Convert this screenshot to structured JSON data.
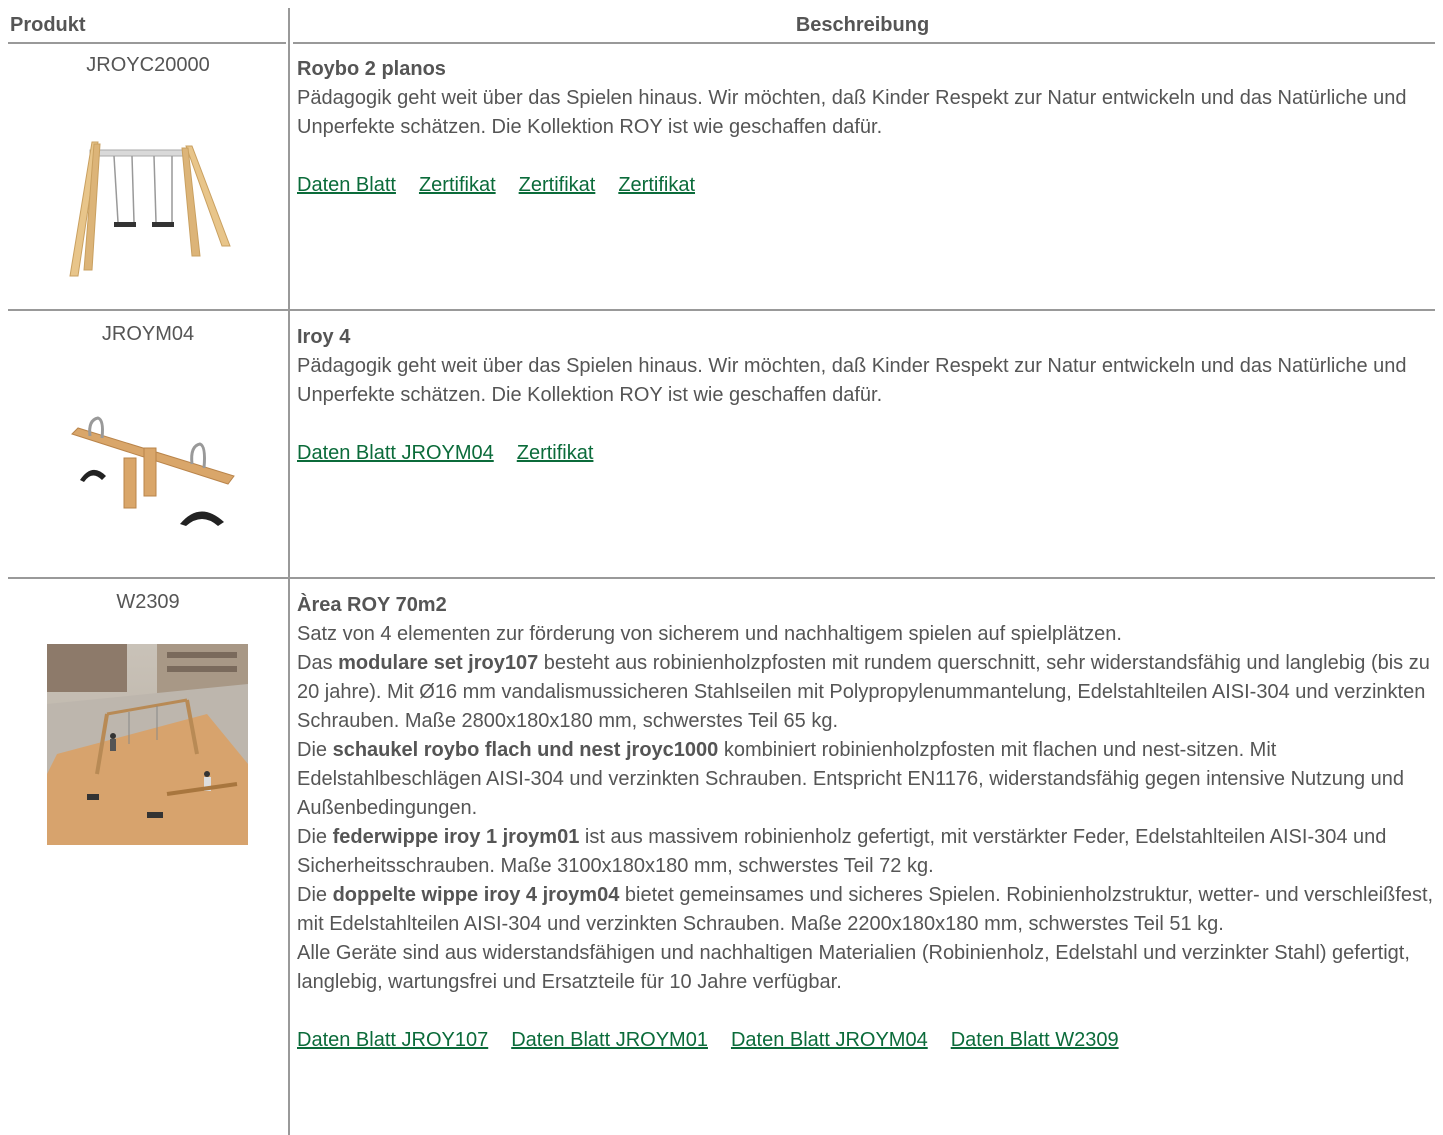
{
  "header": {
    "product": "Produkt",
    "description": "Beschreibung"
  },
  "rows": [
    {
      "code": "JROYC20000",
      "title": "Roybo 2 planos",
      "text": "Pädagogik geht weit über das Spielen hinaus. Wir möchten, daß Kinder Respekt zur Natur entwickeln und das Natürliche und Unperfekte schätzen. Die Kollektion ROY ist wie geschaffen dafür.",
      "links": [
        "Daten Blatt",
        "Zertifikat",
        "Zertifikat",
        "Zertifikat"
      ]
    },
    {
      "code": "JROYM04",
      "title": "Iroy 4",
      "text": "Pädagogik geht weit über das Spielen hinaus. Wir möchten, daß Kinder Respekt zur Natur entwickeln und das Natürliche und Unperfekte schätzen. Die Kollektion ROY ist wie geschaffen dafür.",
      "links": [
        "Daten Blatt JROYM04",
        "Zertifikat"
      ]
    },
    {
      "code": "W2309",
      "title": "Àrea ROY 70m2",
      "intro": "Satz von 4 elementen zur förderung von sicherem und nachhaltigem spielen auf spielplätzen.",
      "p1_pre": "Das ",
      "p1_bold": "modulare set jroy107",
      "p1_post": " besteht aus robinienholzpfosten mit rundem querschnitt, sehr widerstandsfähig und langlebig (bis zu 20 jahre). Mit Ø16 mm vandalismussicheren Stahlseilen mit Polypropylenummantelung, Edelstahlteilen AISI-304 und verzinkten Schrauben. Maße 2800x180x180 mm, schwerstes Teil 65 kg.",
      "p2_pre": "Die ",
      "p2_bold": "schaukel roybo flach und nest jroyc1000",
      "p2_post": " kombiniert robinienholzpfosten mit flachen und nest-sitzen. Mit Edelstahlbeschlägen AISI-304 und verzinkten Schrauben. Entspricht EN1176, widerstandsfähig gegen intensive Nutzung und Außenbedingungen.",
      "p3_pre": "Die ",
      "p3_bold": "federwippe iroy 1 jroym01",
      "p3_post": " ist aus massivem robinienholz gefertigt, mit verstärkter Feder, Edelstahlteilen AISI-304 und Sicherheitsschrauben. Maße 3100x180x180 mm, schwerstes Teil 72 kg.",
      "p4_pre": "Die ",
      "p4_bold": "doppelte wippe iroy 4 jroym04",
      "p4_post": " bietet gemeinsames und sicheres Spielen. Robinienholzstruktur, wetter- und verschleißfest, mit Edelstahlteilen AISI-304 und verzinkten Schrauben. Maße 2200x180x180 mm, schwerstes Teil 51 kg.",
      "p5": "Alle Geräte sind aus widerstandsfähigen und nachhaltigen Materialien (Robinienholz, Edelstahl und verzinkter Stahl) gefertigt, langlebig, wartungsfrei und Ersatzteile für 10 Jahre verfügbar.",
      "links": [
        "Daten Blatt JROY107",
        "Daten Blatt JROYM01",
        "Daten Blatt JROYM04",
        "Daten Blatt W2309"
      ]
    }
  ],
  "colors": {
    "link": "#0b6b3a",
    "text": "#555555",
    "rule": "#999999"
  }
}
